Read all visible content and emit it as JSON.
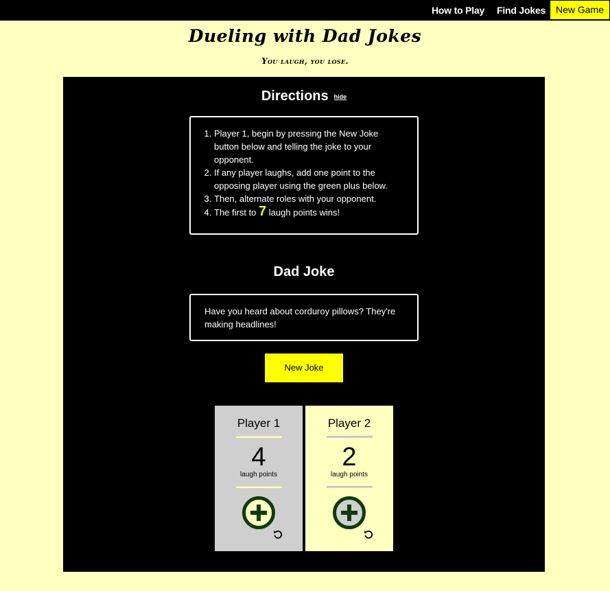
{
  "nav": {
    "how_to_play": "How to Play",
    "find_jokes": "Find Jokes",
    "new_game": "New Game"
  },
  "header": {
    "title": "Dueling with Dad Jokes",
    "subtitle": "You laugh, you lose."
  },
  "directions": {
    "heading": "Directions",
    "hide_label": "hide",
    "items": [
      "Player 1, begin by pressing the New Joke button below and telling the joke to your opponent.",
      "If any player laughs, add one point to the opposing player using the green plus below.",
      "Then, alternate roles with your opponent."
    ],
    "last_item_prefix": "The first to",
    "win_points": "7",
    "last_item_suffix": "laugh points wins!"
  },
  "joke": {
    "heading": "Dad Joke",
    "text": "Have you heard about corduroy pillows? They're making headlines!",
    "new_joke_label": "New Joke"
  },
  "players": [
    {
      "name": "Player 1",
      "score": "4",
      "points_label": "laugh points"
    },
    {
      "name": "Player 2",
      "score": "2",
      "points_label": "laugh points"
    }
  ],
  "colors": {
    "accent": "#ffff00",
    "background": "#ffffc0",
    "panel": "#000000",
    "plus": "#0d3b0d",
    "player1_card": "#cfcfcf"
  },
  "icons": {
    "add": "plus-circle-icon",
    "reset": "undo-icon"
  }
}
